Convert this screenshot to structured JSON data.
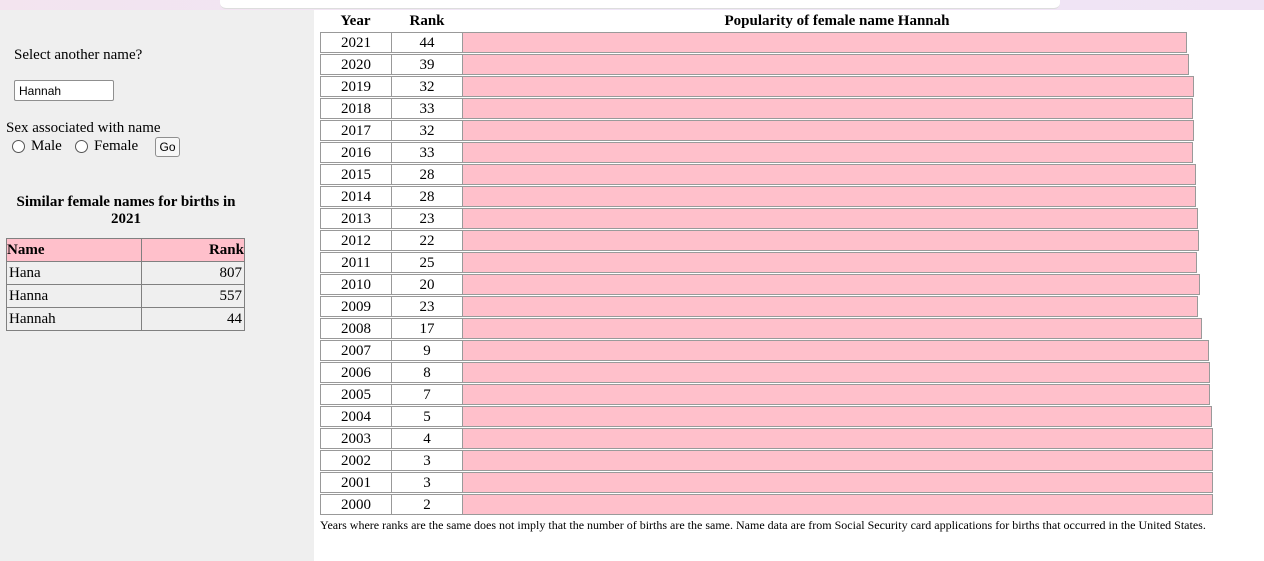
{
  "form": {
    "select_label": "Select another name?",
    "name_value": "Hannah",
    "sex_label": "Sex associated with name",
    "male_label": "Male",
    "female_label": "Female",
    "go_label": "Go"
  },
  "similar": {
    "title": "Similar female names for births in 2021",
    "headers": {
      "name": "Name",
      "rank": "Rank"
    },
    "rows": [
      {
        "name": "Hana",
        "rank": "807"
      },
      {
        "name": "Hanna",
        "rank": "557"
      },
      {
        "name": "Hannah",
        "rank": "44"
      }
    ]
  },
  "ranks": {
    "year_header": "Year",
    "rank_header": "Rank",
    "chart_title": "Popularity of female name Hannah",
    "rows": [
      {
        "year": "2021",
        "rank": "44",
        "popularity": 0.9478
      },
      {
        "year": "2020",
        "rank": "39",
        "popularity": 0.9505
      },
      {
        "year": "2019",
        "rank": "32",
        "popularity": 0.9571
      },
      {
        "year": "2018",
        "rank": "33",
        "popularity": 0.9557
      },
      {
        "year": "2017",
        "rank": "32",
        "popularity": 0.9571
      },
      {
        "year": "2016",
        "rank": "33",
        "popularity": 0.9557
      },
      {
        "year": "2015",
        "rank": "28",
        "popularity": 0.9598
      },
      {
        "year": "2014",
        "rank": "28",
        "popularity": 0.9598
      },
      {
        "year": "2013",
        "rank": "23",
        "popularity": 0.9625
      },
      {
        "year": "2012",
        "rank": "22",
        "popularity": 0.9638
      },
      {
        "year": "2011",
        "rank": "25",
        "popularity": 0.9611
      },
      {
        "year": "2010",
        "rank": "20",
        "popularity": 0.9652
      },
      {
        "year": "2009",
        "rank": "23",
        "popularity": 0.9625
      },
      {
        "year": "2008",
        "rank": "17",
        "popularity": 0.9679
      },
      {
        "year": "2007",
        "rank": "9",
        "popularity": 0.9759
      },
      {
        "year": "2006",
        "rank": "8",
        "popularity": 0.9772
      },
      {
        "year": "2005",
        "rank": "7",
        "popularity": 0.9772
      },
      {
        "year": "2004",
        "rank": "5",
        "popularity": 0.9799
      },
      {
        "year": "2003",
        "rank": "4",
        "popularity": 0.9813
      },
      {
        "year": "2002",
        "rank": "3",
        "popularity": 0.9813
      },
      {
        "year": "2001",
        "rank": "3",
        "popularity": 0.9813
      },
      {
        "year": "2000",
        "rank": "2",
        "popularity": 0.9813
      }
    ]
  },
  "footnote": "Years where ranks are the same does not imply that the number of births are the same. Name data are from Social Security card applications for births that occurred in the United States.",
  "colors": {
    "bar": "#ffc0cb",
    "panel": "#efefef"
  }
}
